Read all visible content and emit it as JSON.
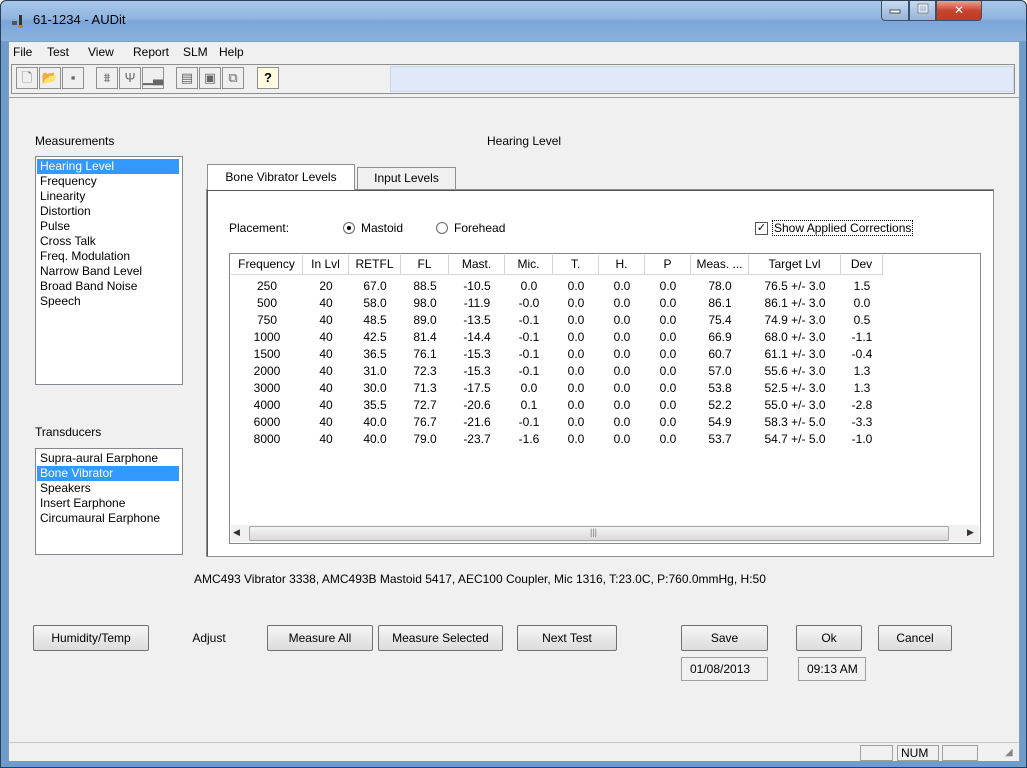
{
  "window": {
    "title": "61-1234 - AUDit"
  },
  "menu": [
    "File",
    "Test",
    "View",
    "Report",
    "SLM",
    "Help"
  ],
  "toolbar": {
    "icons": [
      "new-icon",
      "open-icon",
      "save-icon",
      "meter-icon",
      "probe-icon",
      "bars-icon",
      "page-icon",
      "page2-icon",
      "copy-icon",
      "help-icon"
    ]
  },
  "measurements": {
    "label": "Measurements",
    "items": [
      "Hearing Level",
      "Frequency",
      "Linearity",
      "Distortion",
      "Pulse",
      "Cross Talk",
      "Freq. Modulation",
      "Narrow Band Level",
      "Broad Band Noise",
      "Speech"
    ],
    "selected": "Hearing Level"
  },
  "transducers": {
    "label": "Transducers",
    "items": [
      "Supra-aural Earphone",
      "Bone Vibrator",
      "Speakers",
      "Insert Earphone",
      "Circumaural Earphone"
    ],
    "selected": "Bone Vibrator"
  },
  "heading": "Hearing Level",
  "tabs": [
    "Bone Vibrator Levels",
    "Input Levels"
  ],
  "placement": {
    "label": "Placement:",
    "mastoid": "Mastoid",
    "forehead": "Forehead",
    "selected": "Mastoid"
  },
  "show_corrections": {
    "label": "Show Applied Corrections",
    "checked": true
  },
  "table": {
    "columns": [
      "Frequency",
      "In Lvl",
      "RETFL",
      "FL",
      "Mast.",
      "Mic.",
      "T.",
      "H.",
      "P",
      "Meas. ...",
      "Target Lvl",
      "Dev"
    ],
    "rows": [
      [
        "250",
        "20",
        "67.0",
        "88.5",
        "-10.5",
        "0.0",
        "0.0",
        "0.0",
        "0.0",
        "78.0",
        "76.5 +/- 3.0",
        "1.5"
      ],
      [
        "500",
        "40",
        "58.0",
        "98.0",
        "-11.9",
        "-0.0",
        "0.0",
        "0.0",
        "0.0",
        "86.1",
        "86.1 +/- 3.0",
        "0.0"
      ],
      [
        "750",
        "40",
        "48.5",
        "89.0",
        "-13.5",
        "-0.1",
        "0.0",
        "0.0",
        "0.0",
        "75.4",
        "74.9 +/- 3.0",
        "0.5"
      ],
      [
        "1000",
        "40",
        "42.5",
        "81.4",
        "-14.4",
        "-0.1",
        "0.0",
        "0.0",
        "0.0",
        "66.9",
        "68.0 +/- 3.0",
        "-1.1"
      ],
      [
        "1500",
        "40",
        "36.5",
        "76.1",
        "-15.3",
        "-0.1",
        "0.0",
        "0.0",
        "0.0",
        "60.7",
        "61.1 +/- 3.0",
        "-0.4"
      ],
      [
        "2000",
        "40",
        "31.0",
        "72.3",
        "-15.3",
        "-0.1",
        "0.0",
        "0.0",
        "0.0",
        "57.0",
        "55.6 +/- 3.0",
        "1.3"
      ],
      [
        "3000",
        "40",
        "30.0",
        "71.3",
        "-17.5",
        "0.0",
        "0.0",
        "0.0",
        "0.0",
        "53.8",
        "52.5 +/- 3.0",
        "1.3"
      ],
      [
        "4000",
        "40",
        "35.5",
        "72.7",
        "-20.6",
        "0.1",
        "0.0",
        "0.0",
        "0.0",
        "52.2",
        "55.0 +/- 3.0",
        "-2.8"
      ],
      [
        "6000",
        "40",
        "40.0",
        "76.7",
        "-21.6",
        "-0.1",
        "0.0",
        "0.0",
        "0.0",
        "54.9",
        "58.3 +/- 5.0",
        "-3.3"
      ],
      [
        "8000",
        "40",
        "40.0",
        "79.0",
        "-23.7",
        "-1.6",
        "0.0",
        "0.0",
        "0.0",
        "53.7",
        "54.7 +/- 5.0",
        "-1.0"
      ]
    ]
  },
  "equipment_line": "AMC493 Vibrator 3338, AMC493B Mastoid 5417, AEC100 Coupler, Mic 1316, T:23.0C, P:760.0mmHg, H:50",
  "buttons": {
    "humidity": "Humidity/Temp",
    "adjust": "Adjust",
    "measure_all": "Measure All",
    "measure_selected": "Measure Selected",
    "next_test": "Next Test",
    "save": "Save",
    "ok": "Ok",
    "cancel": "Cancel"
  },
  "date": "01/08/2013",
  "time": "09:13 AM",
  "status": {
    "num": "NUM"
  }
}
